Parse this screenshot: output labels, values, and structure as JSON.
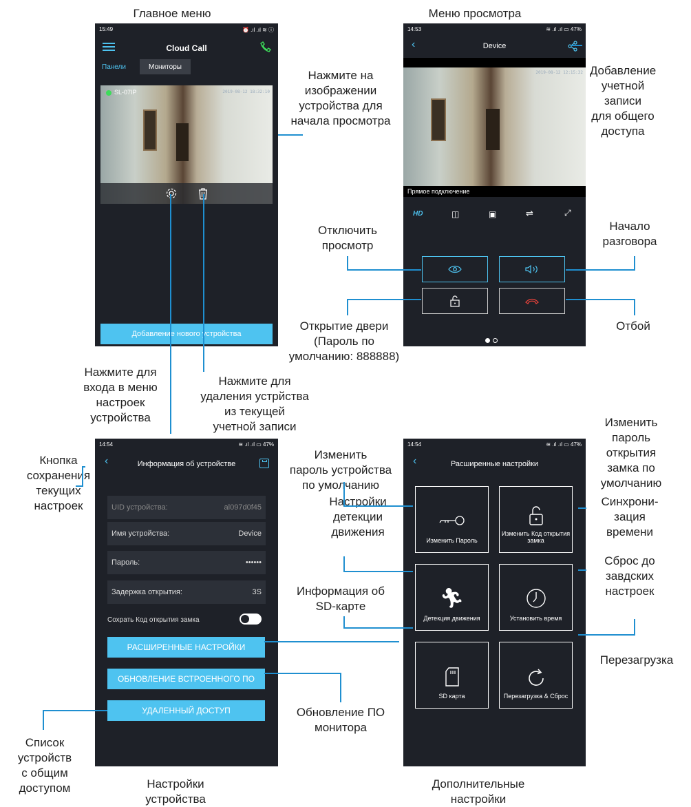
{
  "captions": {
    "main_menu": "Главное меню",
    "view_menu": "Меню просмотра",
    "tap_image": "Нажмите на\nизображении\nустройства для\nначала просмотра",
    "share_account": "Добавление\nучетной\nзаписи\nдля общего\nдоступа",
    "stop_view": "Отключить\nпросмотр",
    "start_talk": "Начало\nразговора",
    "open_door": "Открытие двери\n(Пароль по\nумолчанию: 888888)",
    "hangup": "Отбой",
    "tap_settings": "Нажмите для\nвхода в меню\nнастроек\nустройства",
    "tap_delete": "Нажмите для\nудаления устрйства\nиз текущей\nучетной записи",
    "save_button": "Кнопка\nсохранения\nтекущих\nнастроек",
    "change_password": "Изменить\nпароль устройства\nпо умолчанию",
    "change_lock_password": "Изменить\nпароль\nоткрытия\nзамка по\nумолчанию",
    "motion_settings": "Настройки\nдетекции\nдвижения",
    "time_sync": "Синхрони-\nзация\nвремени",
    "factory_reset": "Сброс до\nзавдских\nнастроек",
    "sd_info": "Информация об\nSD-карте",
    "reboot": "Перезагрузка",
    "firmware_update": "Обновление ПО\nмонитора",
    "shared_list": "Список\nустройств\nс общим\nдоступом",
    "device_settings": "Настройки\nустройства",
    "advanced_settings": "Дополнительные\nнастройки"
  },
  "phone1": {
    "time": "15:49",
    "status_icons": "⏰ .ıl .ıl ≋ ⓘ",
    "title": "Cloud Call",
    "tab_panels": "Панели",
    "tab_monitors": "Мониторы",
    "device_name": "SL-07IP",
    "timestamp": "2019-08-12 18:32:10",
    "add_device": "Добавление нового устройства"
  },
  "phone2": {
    "time": "14:53",
    "status_icons": "≋ .ıl .ıl ▭ 47%",
    "title": "Device",
    "timestamp": "2019-08-12 12:15:32",
    "connection": "Прямое подключение",
    "hd_label": "HD"
  },
  "phone3": {
    "time": "14:54",
    "status_icons": "≋ .ıl .ıl ▭ 47%",
    "title": "Информация об устройстве",
    "uid_label": "UID устройства:",
    "uid_value": "al097d0f45",
    "name_label": "Имя устройства:",
    "name_value": "Device",
    "password_label": "Пароль:",
    "password_value": "••••••",
    "delay_label": "Задержка открытия:",
    "delay_value": "3S",
    "save_lock_label": "Сохрать Код открытия замка",
    "btn_advanced": "РАСШИРЕННЫЕ НАСТРОЙКИ",
    "btn_firmware": "ОБНОВЛЕНИЕ ВСТРОЕННОГО ПО",
    "btn_remote": "УДАЛЕННЫЙ ДОСТУП"
  },
  "phone4": {
    "time": "14:54",
    "status_icons": "≋ .ıl .ıl ▭ 47%",
    "title": "Расширенные настройки",
    "tile_password": "Изменить Пароль",
    "tile_lock_code": "Изменить Код открытия замка",
    "tile_motion": "Детекция движения",
    "tile_time": "Установить время",
    "tile_sd": "SD карта",
    "tile_reboot": "Перезагрузка & Сброс"
  },
  "colors": {
    "accent": "#4ec3f0",
    "phone_bg": "#1e2128",
    "hangup_red": "#e0413a",
    "online_green": "#3ddc5a"
  }
}
